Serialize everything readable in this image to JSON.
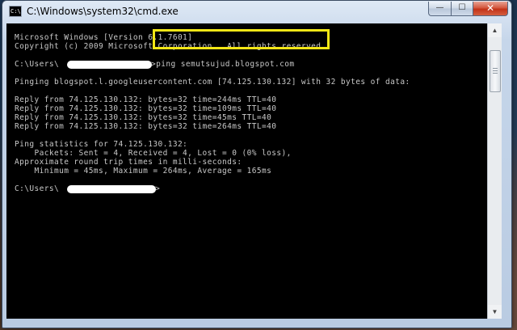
{
  "window": {
    "title": "C:\\Windows\\system32\\cmd.exe",
    "icon_text": "C:\\",
    "controls": {
      "minimize": "—",
      "maximize": "☐",
      "close": "✕"
    }
  },
  "console": {
    "lines": [
      "Microsoft Windows [Version 6.1.7601]",
      "Copyright (c) 2009 Microsoft Corporation.  All rights reserved.",
      "",
      "C:\\Users\\",
      "",
      "Pinging blogspot.l.googleusercontent.com [74.125.130.132] with 32 bytes of data:",
      "",
      "Reply from 74.125.130.132: bytes=32 time=244ms TTL=40",
      "Reply from 74.125.130.132: bytes=32 time=109ms TTL=40",
      "Reply from 74.125.130.132: bytes=32 time=45ms TTL=40",
      "Reply from 74.125.130.132: bytes=32 time=264ms TTL=40",
      "",
      "Ping statistics for 74.125.130.132:",
      "    Packets: Sent = 4, Received = 4, Lost = 0 (0% loss),",
      "Approximate round trip times in milli-seconds:",
      "    Minimum = 45ms, Maximum = 264ms, Average = 165ms",
      "",
      "C:\\Users\\"
    ],
    "command": ">ping semutsujud.blogspot.com",
    "final_prompt_suffix": ">"
  },
  "scrollbar": {
    "up": "▲",
    "down": "▼"
  }
}
